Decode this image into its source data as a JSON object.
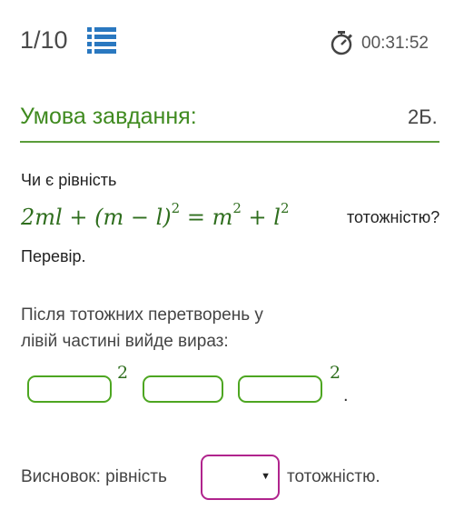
{
  "header": {
    "counter": "1/10",
    "timer": "00:31:52"
  },
  "task": {
    "title": "Умова завдання:",
    "points": "2Б."
  },
  "question": {
    "line1": "Чи є рівність",
    "tail": "тотожністю?",
    "line3": "Перевір."
  },
  "instructions": {
    "line1": "Після тотожних перетворень у",
    "line2": "лівій частині вийде вираз:",
    "exponent": "2",
    "period": "."
  },
  "conclusion": {
    "prefix": "Висновок: рівність",
    "suffix": "тотожністю.",
    "dropdown_value": ""
  },
  "colors": {
    "accent_green": "#4da621",
    "title_green": "#3f8a1f",
    "dropdown_border": "#b0248d",
    "icon_blue": "#2a78c0"
  },
  "icons": [
    "list-icon",
    "stopwatch-icon",
    "chevron-down-icon"
  ]
}
